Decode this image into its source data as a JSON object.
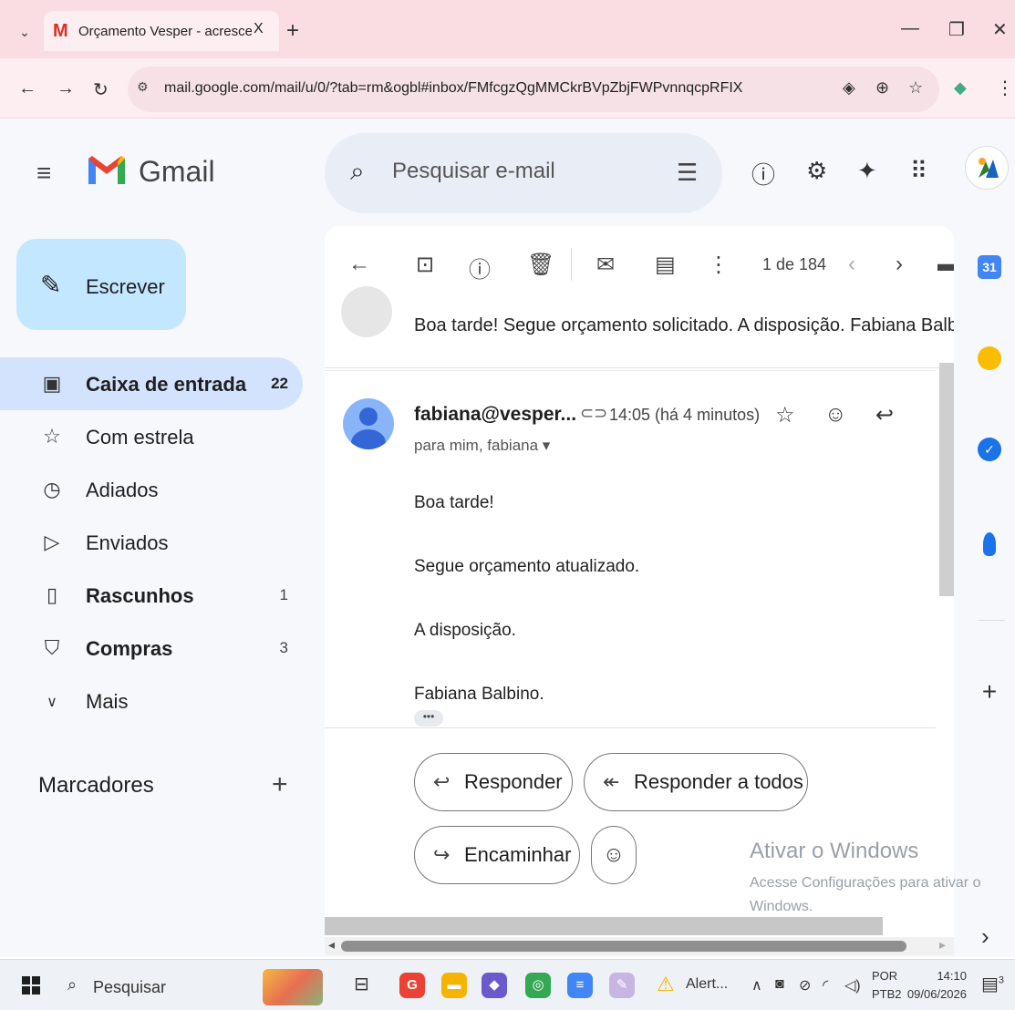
{
  "browser": {
    "tab_title": "Orçamento Vesper - acrescerjur",
    "tab_close": "X",
    "new_tab": "+",
    "url": "mail.google.com/mail/u/0/?tab=rm&ogbl#inbox/FMfcgzQgMMCkrBVpZbjFWPvnnqcpRFIX"
  },
  "gmail": {
    "logo_text": "Gmail",
    "search_placeholder": "Pesquisar e-mail",
    "compose_label": "Escrever",
    "nav": [
      {
        "label": "Caixa de entrada",
        "count": "22",
        "icon": "inbox-icon"
      },
      {
        "label": "Com estrela",
        "count": "",
        "icon": "star-icon"
      },
      {
        "label": "Adiados",
        "count": "",
        "icon": "clock-icon"
      },
      {
        "label": "Enviados",
        "count": "",
        "icon": "send-icon"
      },
      {
        "label": "Rascunhos",
        "count": "1",
        "icon": "draft-icon"
      },
      {
        "label": "Compras",
        "count": "3",
        "icon": "shopping-icon"
      },
      {
        "label": "Mais",
        "count": "",
        "icon": "chevron-down-icon"
      }
    ],
    "labels_title": "Marcadores",
    "labels_add": "+"
  },
  "toolbar": {
    "pager": "1 de 184"
  },
  "thread": {
    "collapsed_snippet": "Boa tarde! Segue orçamento solicitado. A disposição. Fabiana Balbino.",
    "message": {
      "sender": "fabiana@vesper...",
      "time": "14:05 (há 4 minutos)",
      "recipients": "para mim, fabiana",
      "body": [
        "Boa tarde!",
        "Segue orçamento atualizado.",
        "A disposição.",
        "Fabiana Balbino."
      ],
      "trimmed": "•••"
    },
    "actions": {
      "reply": "Responder",
      "reply_all": "Responder a todos",
      "forward": "Encaminhar"
    }
  },
  "watermark": {
    "title": "Ativar o Windows",
    "subtitle": "Acesse Configurações para ativar o Windows."
  },
  "taskbar": {
    "search_label": "Pesquisar",
    "alert_label": "Alert...",
    "lang_1": "POR",
    "lang_2": "PTB2",
    "time": "14:10",
    "date": "09/06/2026",
    "notif_count": "3"
  },
  "sidepanel": {
    "calendar_day": "31"
  },
  "colors": {
    "tab_strip": "#f9dde3",
    "compose": "#c2e7ff",
    "active_nav": "#d3e3fd",
    "app_bg": "#f6f8fc"
  }
}
